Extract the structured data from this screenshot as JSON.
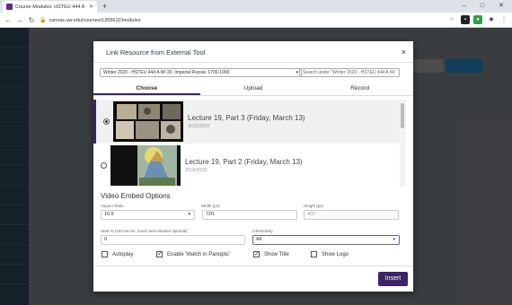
{
  "browser": {
    "tab_title": "Course Modules: HSTEU 444 A Wi...",
    "url": "canvas.uw.edu/courses/1355611/modules",
    "new_tab": "+",
    "min": "–",
    "max": "□",
    "close": "✕"
  },
  "modal": {
    "title": "Link Resource from External Tool",
    "close_glyph": "×",
    "course_select": "Winter 2020 - HSTEU 444 A Wi 20: Imperial Russia: 1700-1900",
    "search_placeholder": "Search under \"Winter 2020 - HSTEU 444 A Wi",
    "tabs": [
      {
        "label": "Choose"
      },
      {
        "label": "Upload"
      },
      {
        "label": "Record"
      }
    ],
    "items": [
      {
        "title": "Lecture 19, Part 3 (Friday, March 13)",
        "date": "3/13/2020"
      },
      {
        "title": "Lecture 19, Part 2 (Friday, March 13)",
        "date": "3/13/2020"
      }
    ],
    "options": {
      "heading": "Video Embed Options",
      "aspect_label": "Aspect Ratio",
      "aspect_value": "16:9",
      "width_label": "Width (px)",
      "width_value": "720",
      "height_label": "Height (px)",
      "height_value": "405",
      "start_label": "Start At (HH:mm:ss, hours and minutes optional)",
      "start_value": "0",
      "interactivity_label": "Interactivity",
      "interactivity_value": "All",
      "checkboxes": [
        {
          "label": "Autoplay",
          "checked": false
        },
        {
          "label": "Enable 'Watch in Panopto'",
          "checked": true
        },
        {
          "label": "Show Title",
          "checked": true
        },
        {
          "label": "Show Logo",
          "checked": false
        }
      ]
    },
    "insert_label": "Insert"
  }
}
